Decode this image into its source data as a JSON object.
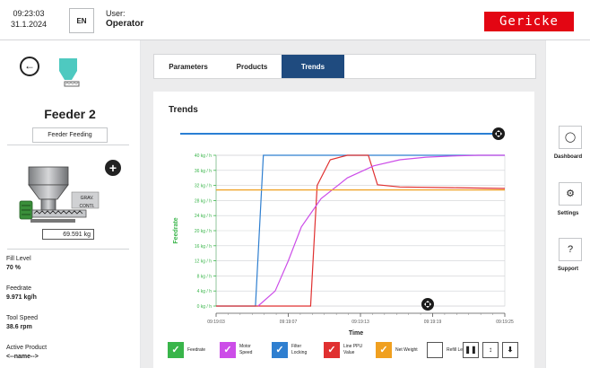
{
  "topbar": {
    "time": "09:23:03",
    "date": "31.1.2024",
    "language": "EN",
    "user_label": "User:",
    "user_value": "Operator",
    "brand": "Gericke"
  },
  "left": {
    "feeder_name": "Feeder 2",
    "feeder_status": "Feeder Feeding",
    "diagram_label_1": "GRAV.",
    "diagram_label_2": "CONTI.",
    "weight": "69.591 kg",
    "stats": [
      {
        "label": "Fill Level",
        "value": "70 %"
      },
      {
        "label": "Feedrate",
        "value": "9.971 kg/h"
      },
      {
        "label": "Tool Speed",
        "value": "38.6 rpm"
      },
      {
        "label": "Active Product",
        "value": "<--name-->"
      }
    ]
  },
  "tabs": {
    "parameters": "Parameters",
    "products": "Products",
    "trends": "Trends"
  },
  "trends": {
    "title": "Trends"
  },
  "chart_data": {
    "type": "line",
    "xlabel": "Time",
    "ylabel": "Feedrate",
    "x_ticks": [
      "09:19:03",
      "09:19:07",
      "09:19:13",
      "09:19:19",
      "09:19:25"
    ],
    "y_ticks": [
      "0 kg / h",
      "4 kg / h",
      "8 kg / h",
      "12 kg / h",
      "16 kg / h",
      "20 kg / h",
      "24 kg / h",
      "28 kg / h",
      "32 kg / h",
      "36 kg / h",
      "40 kg / h"
    ],
    "ylim": [
      0,
      40
    ],
    "xlim": [
      0,
      22
    ],
    "grid": true,
    "series": [
      {
        "name": "Filter Locking",
        "color": "#2f7fd0",
        "x": [
          0,
          3,
          3.6,
          22
        ],
        "y": [
          0,
          0,
          40,
          40
        ]
      },
      {
        "name": "Line PPU Value",
        "color": "#e03030",
        "x": [
          0,
          6.5,
          7.2,
          7.7,
          8.7,
          10,
          11.6,
          12.3,
          14,
          18,
          22
        ],
        "y": [
          0,
          0,
          0,
          32,
          38.8,
          40,
          40,
          32.2,
          31.6,
          31.4,
          31.2
        ]
      },
      {
        "name": "Motor Speed",
        "color": "#cc4de8",
        "x": [
          3.2,
          4.5,
          5.5,
          6.5,
          8,
          10,
          12,
          14,
          16,
          18,
          20,
          22
        ],
        "y": [
          0,
          4,
          12,
          21,
          28.5,
          34,
          37.2,
          38.8,
          39.5,
          39.8,
          40,
          40
        ]
      },
      {
        "name": "Net Weight",
        "color": "#f0a020",
        "x": [
          0,
          22
        ],
        "y": [
          30.8,
          30.8
        ]
      }
    ]
  },
  "legend": [
    {
      "name": "Feedrate",
      "color": "#39b54a",
      "checked": true
    },
    {
      "name": "Motor Speed",
      "color": "#cc4de8",
      "checked": true
    },
    {
      "name": "Filter Locking",
      "color": "#2f7fd0",
      "checked": true
    },
    {
      "name": "Line PPU Value",
      "color": "#e03030",
      "checked": true
    },
    {
      "name": "Net Weight",
      "color": "#f0a020",
      "checked": true
    },
    {
      "name": "Refill Level",
      "color": "#ffffff",
      "checked": false
    }
  ],
  "right": {
    "dashboard": "Dashboard",
    "settings": "Settings",
    "support": "Support"
  },
  "icons": [
    "back-arrow-icon",
    "hopper-icon",
    "plus-icon",
    "dashboard-icon",
    "gear-icon",
    "help-icon",
    "pause-icon",
    "fit-icon",
    "download-icon"
  ]
}
